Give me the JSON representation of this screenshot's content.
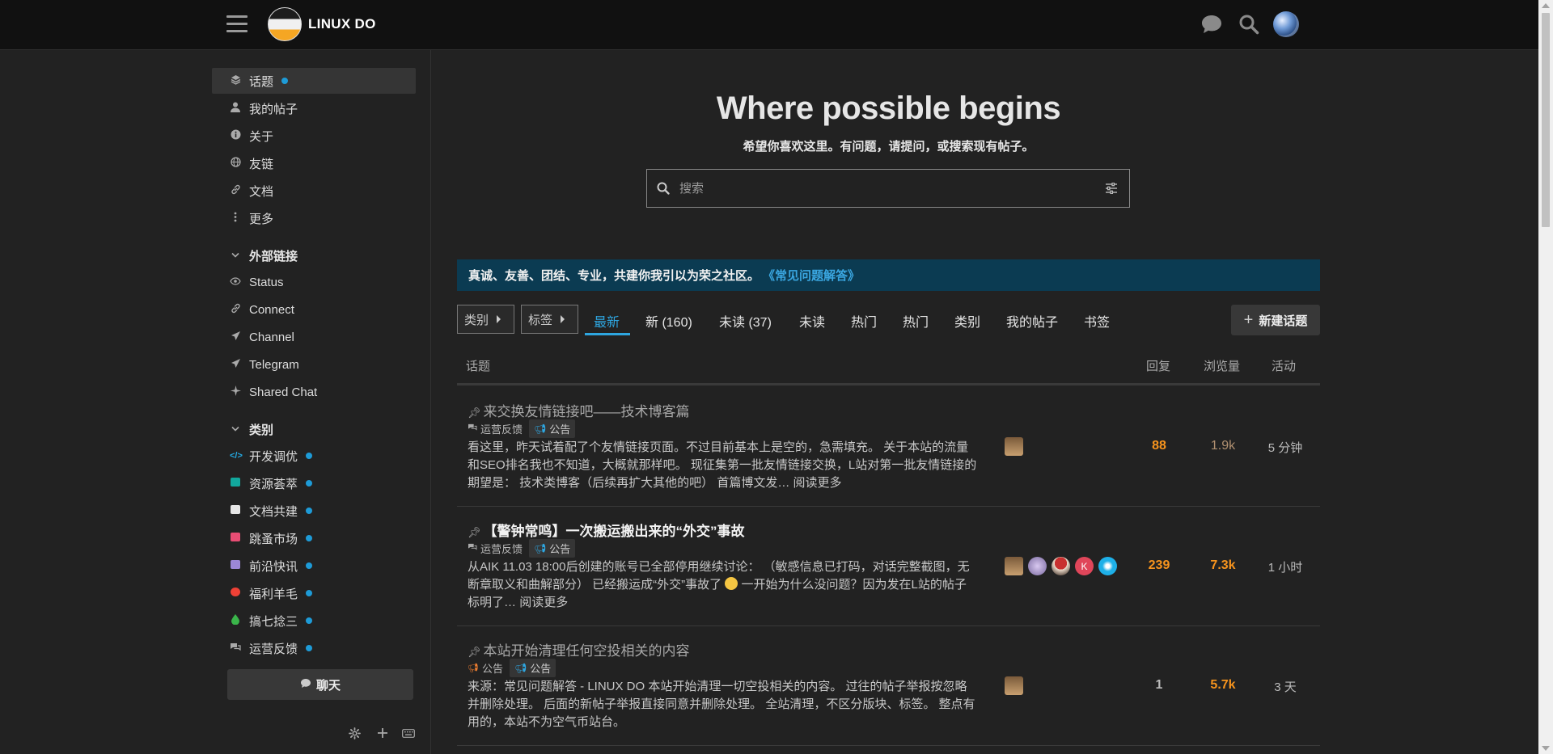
{
  "header": {
    "logo_text": "LINUX DO",
    "icons": [
      "hamburger-menu-icon",
      "chat-bubble-icon",
      "search-icon",
      "user-avatar"
    ]
  },
  "sidebar": {
    "items": [
      {
        "label": "话题",
        "icon": "layers-icon",
        "dot": true
      },
      {
        "label": "我的帖子",
        "icon": "user-icon"
      },
      {
        "label": "关于",
        "icon": "info-icon"
      },
      {
        "label": "友链",
        "icon": "globe-icon"
      },
      {
        "label": "文档",
        "icon": "link-icon"
      },
      {
        "label": "更多",
        "icon": "more-vertical-icon"
      }
    ],
    "external_section": {
      "label": "外部链接",
      "items": [
        {
          "label": "Status",
          "icon": "eye-icon"
        },
        {
          "label": "Connect",
          "icon": "link-icon"
        },
        {
          "label": "Channel",
          "icon": "paper-plane-icon"
        },
        {
          "label": "Telegram",
          "icon": "paper-plane-icon"
        },
        {
          "label": "Shared Chat",
          "icon": "sparkle-icon"
        }
      ]
    },
    "categories_section": {
      "label": "类别",
      "items": [
        {
          "label": "开发调优",
          "color": "#25aae2",
          "dot": true
        },
        {
          "label": "资源荟萃",
          "color": "#12a89d",
          "dot": true
        },
        {
          "label": "文档共建",
          "color": "#e6e6e6",
          "dot": true
        },
        {
          "label": "跳蚤市场",
          "color": "#e84d74",
          "dot": true
        },
        {
          "label": "前沿快讯",
          "color": "#9c87d6",
          "dot": true
        },
        {
          "label": "福利羊毛",
          "color": "#ef4136",
          "dot": true
        },
        {
          "label": "搞七捻三",
          "color": "#3ab54a",
          "dot": true
        },
        {
          "label": "运营反馈",
          "color": "#aaaaaa",
          "dot": true
        }
      ]
    },
    "chat_button": "聊天",
    "bottom_icons": [
      "settings-icon",
      "plus-icon",
      "keyboard-icon"
    ]
  },
  "hero": {
    "title": "Where possible begins",
    "subtitle": "希望你喜欢这里。有问题，请提问，或搜索现有帖子。",
    "search_placeholder": "搜索"
  },
  "banner": {
    "text": "真诚、友善、团结、专业，共建你我引以为荣之社区。",
    "link": "《常见问题解答》"
  },
  "nav": {
    "categories_dropdown": "类别",
    "tags_dropdown": "标签",
    "tabs": [
      "最新",
      "新 (160)",
      "未读 (37)",
      "未读",
      "热门",
      "热门",
      "类别",
      "我的帖子",
      "书签"
    ],
    "active_tab": "最新",
    "new_topic": "新建话题"
  },
  "table": {
    "headers": [
      "话题",
      "回复",
      "浏览量",
      "活动"
    ],
    "colors": {
      "replies_hot": "#f7941d",
      "views_hot": "#f7941d",
      "views_mid": "#b09070",
      "neutral": "#bbbbbb"
    },
    "rows": [
      {
        "title": "来交换友情链接吧——技术博客篇",
        "visited": true,
        "category": "运营反馈",
        "tags": [
          "公告"
        ],
        "excerpt": "看这里，昨天试着配了个友情链接页面。不过目前基本上是空的，急需填充。 关于本站的流量和SEO排名我也不知道，大概就那样吧。 现征集第一批友情链接交换，L站对第一批友情链接的期望是： 技术类博客（后续再扩大其他的吧） 首篇博文发…",
        "read_more": "阅读更多",
        "replies": "88",
        "views": "1.9k",
        "activity": "5 分钟"
      },
      {
        "title": "【警钟常鸣】一次搬运搬出来的“外交”事故",
        "visited": false,
        "category": "运营反馈",
        "tags": [
          "公告"
        ],
        "excerpt_before": "从AIK 11.03 18:00后创建的账号已全部停用继续讨论： （敏感信息已打码，对话完整截图，无断章取义和曲解部分） 已经搬运成“外交”事故了 ",
        "excerpt_after": " 一开始为什么没问题？因为发在L站的帖子标明了…",
        "read_more": "阅读更多",
        "replies": "239",
        "views": "7.3k",
        "activity": "1 小时"
      },
      {
        "title": "本站开始清理任何空投相关的内容",
        "visited": true,
        "category": "公告",
        "tags": [
          "公告"
        ],
        "excerpt": "来源：常见问题解答 - LINUX DO 本站开始清理一切空投相关的内容。 过往的帖子举报按忽略并删除处理。 后面的新帖子举报直接同意并删除处理。 全站清理，不区分版块、标签。 整点有用的，本站不为空气币站台。",
        "replies": "1",
        "views": "5.7k",
        "activity": "3 天"
      }
    ]
  }
}
